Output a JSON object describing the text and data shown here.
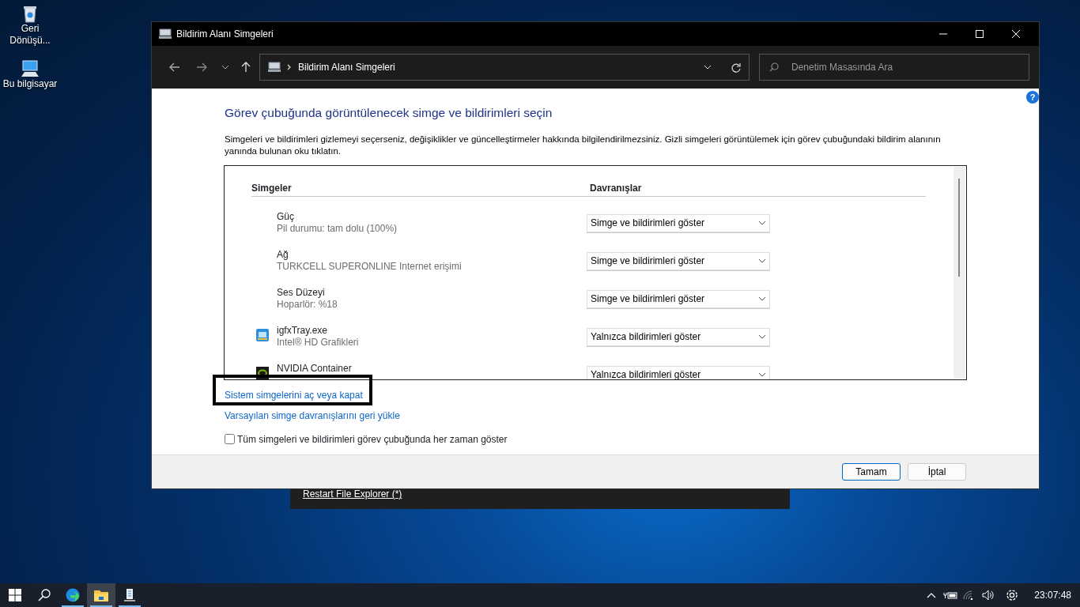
{
  "desktop": {
    "icons": [
      {
        "kind": "recycle",
        "label": "Geri Dönüşü..."
      },
      {
        "kind": "computer",
        "label": "Bu bilgisayar"
      }
    ]
  },
  "background_panel": {
    "link": "Restart File Explorer (*)"
  },
  "window": {
    "title": "Bildirim Alanı Simgeleri",
    "address": "Bildirim Alanı Simgeleri",
    "search": {
      "placeholder": "Denetim Masasında Ara"
    },
    "help": "?",
    "heading": "Görev çubuğunda görüntülenecek simge ve bildirimleri seçin",
    "description": "Simgeleri ve bildirimleri gizlemeyi seçerseniz, değişiklikler ve güncelleştirmeler hakkında bilgilendirilmezsiniz. Gizli simgeleri görüntülemek için görev çubuğundaki bildirim alanının yanında bulunan oku tıklatın.",
    "table": {
      "columns": [
        "Simgeler",
        "Davranışlar"
      ],
      "rows": [
        {
          "kind": "plain",
          "name": "Güç",
          "detail": "Pil durumu: tam dolu (100%)",
          "behavior": "Simge ve bildirimleri göster"
        },
        {
          "kind": "plain",
          "name": "Ağ",
          "detail": "TURKCELL SUPERONLINE Internet erişimi",
          "behavior": "Simge ve bildirimleri göster"
        },
        {
          "kind": "plain",
          "name": "Ses Düzeyi",
          "detail": "Hoparlör: %18",
          "behavior": "Simge ve bildirimleri göster"
        },
        {
          "kind": "display-app",
          "name": "igfxTray.exe",
          "detail": "Intel® HD Grafikleri",
          "behavior": "Yalnızca bildirimleri göster"
        },
        {
          "kind": "app",
          "name": "NVIDIA Container",
          "behavior": "Yalnızca bildirimleri göster"
        }
      ]
    },
    "links": [
      {
        "label": "Sistem simgelerini aç veya kapat",
        "highlighted": true
      },
      {
        "label": "Varsayılan simge davranışlarını geri yükle",
        "highlighted": false
      }
    ],
    "checkbox": {
      "label": "Tüm simgeleri ve bildirimleri görev çubuğunda her zaman göster",
      "checked": false
    },
    "buttons": [
      {
        "label": "Tamam",
        "default": true
      },
      {
        "label": "İptal",
        "default": false
      }
    ]
  },
  "taskbar": {
    "apps": [
      {
        "kind": "edge",
        "selected": false
      },
      {
        "kind": "explorer",
        "selected": true
      },
      {
        "kind": "control-panel",
        "selected": false
      }
    ],
    "clock": "23:07:48"
  }
}
